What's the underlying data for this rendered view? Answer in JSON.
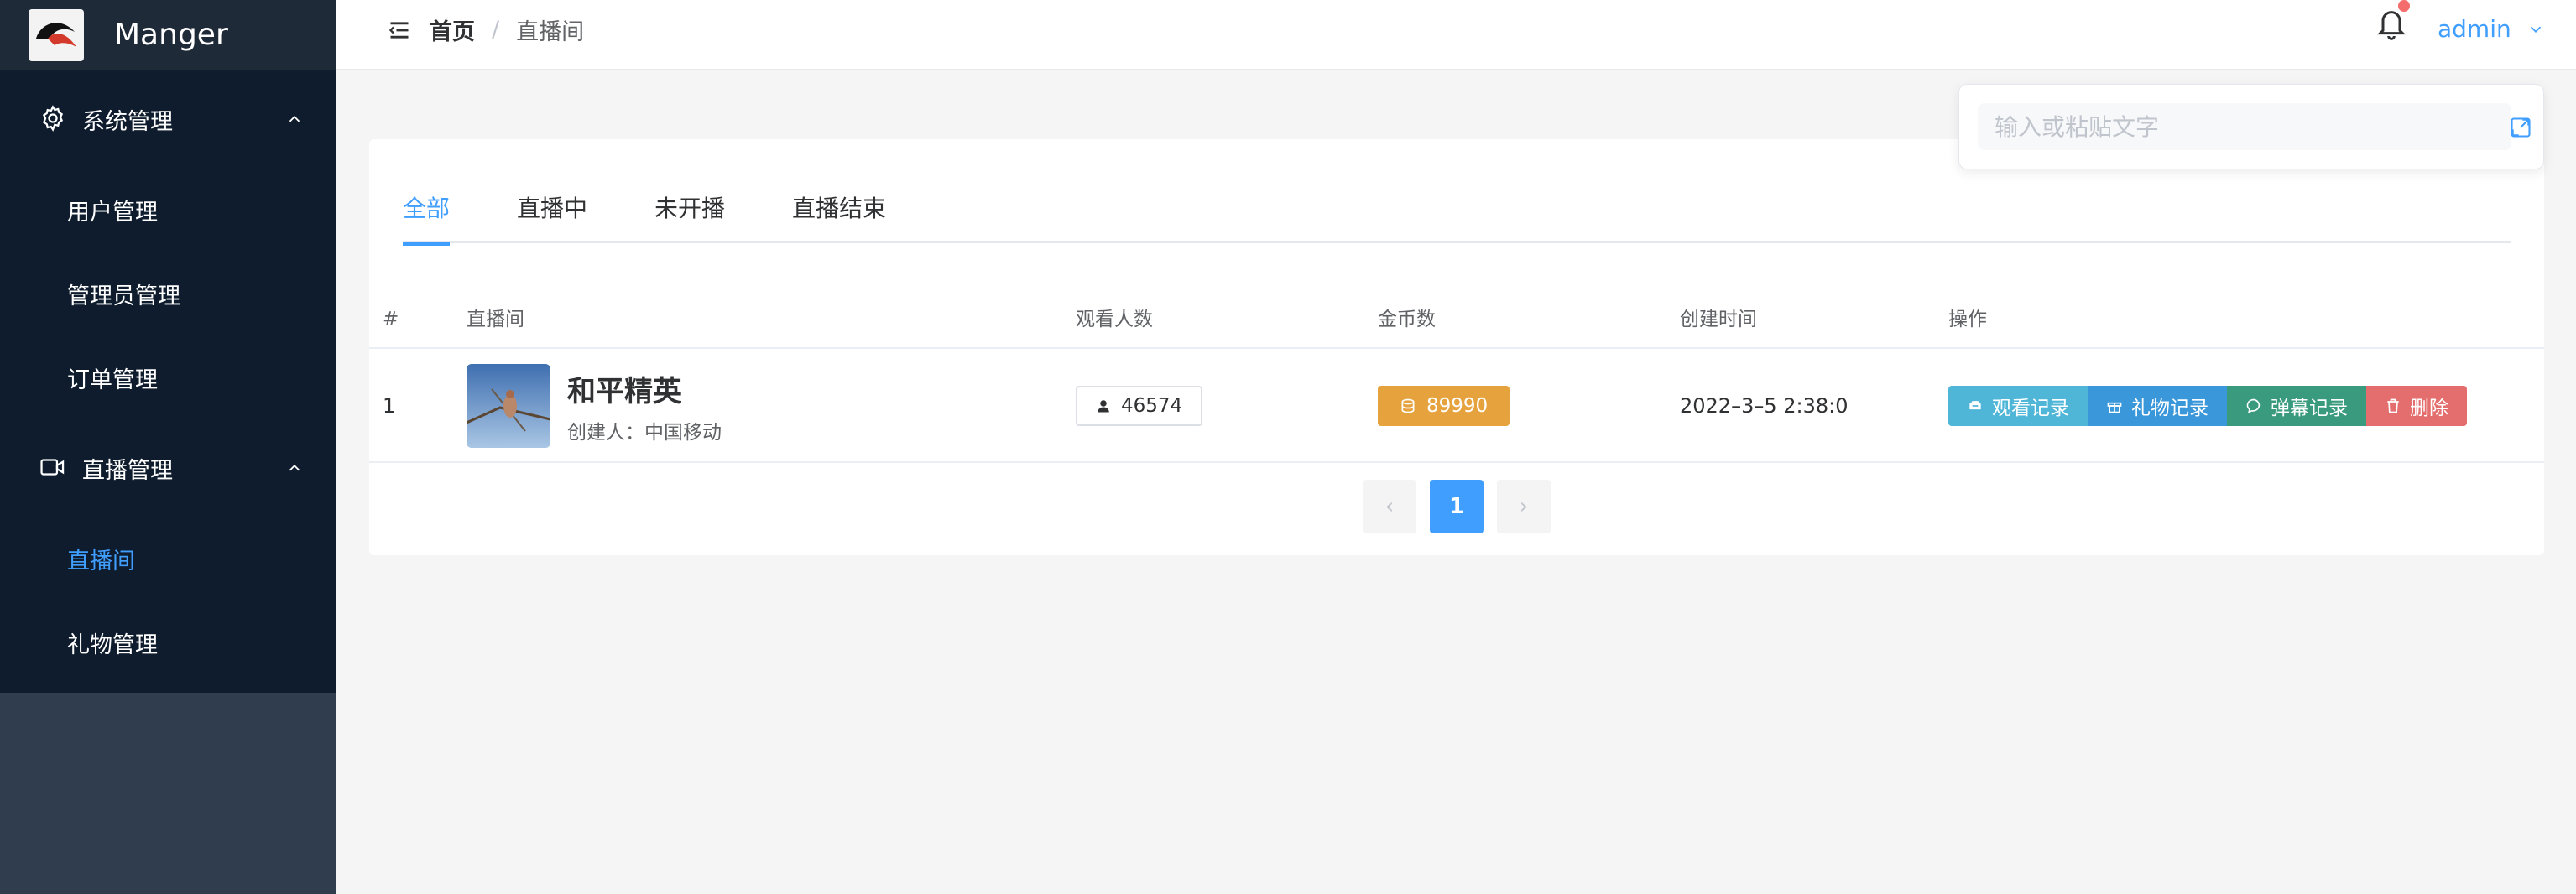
{
  "app": {
    "title": "Manger"
  },
  "sidebar": {
    "groups": [
      {
        "label": "系统管理",
        "items": [
          "用户管理",
          "管理员管理",
          "订单管理"
        ]
      },
      {
        "label": "直播管理",
        "items": [
          "直播间",
          "礼物管理"
        ]
      }
    ],
    "active_item": "直播间"
  },
  "header": {
    "breadcrumb_home": "首页",
    "breadcrumb_sep": "/",
    "breadcrumb_current": "直播间",
    "user": "admin"
  },
  "float_input": {
    "placeholder": "输入或粘贴文字"
  },
  "tabs": [
    "全部",
    "直播中",
    "未开播",
    "直播结束"
  ],
  "table": {
    "columns": [
      "#",
      "直播间",
      "观看人数",
      "金币数",
      "创建时间",
      "操作"
    ],
    "rows": [
      {
        "index": "1",
        "room_name": "和平精英",
        "creator": "创建人：中国移动",
        "viewers": "46574",
        "coins": "89990",
        "created_at": "2022–3–5 2:38:0",
        "actions": [
          "观看记录",
          "礼物记录",
          "弹幕记录",
          "删除"
        ]
      }
    ]
  },
  "pagination": {
    "prev": "‹",
    "current": "1",
    "next": "›"
  },
  "colors": {
    "accent": "#409eff",
    "sidebar": "#0e1c2d",
    "coin": "#e6a23c",
    "danger": "#e46d6d"
  }
}
